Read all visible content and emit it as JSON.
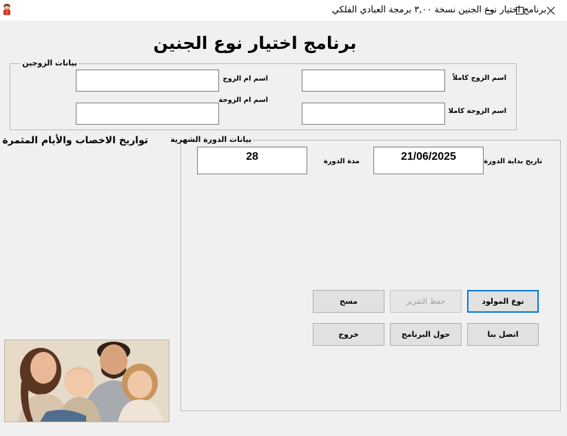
{
  "window": {
    "title": "برنامج اختيار نوع الجنين  نسخة ٣,٠٠ برمجة العبادي الفلكي",
    "icon": "app-icon"
  },
  "heading": "برنامج  اختيار نوع الجنين",
  "couple_group": {
    "legend": "بيانات الزوجين",
    "husband_full_name_label": "اسم الزوج كاملاً",
    "husband_mother_label": "اسم ام الزوج",
    "wife_full_name_label": "اسم الزوجة كاملا",
    "wife_mother_label": "اسم ام الزوجة",
    "husband_full_name_value": "",
    "husband_mother_value": "",
    "wife_full_name_value": "",
    "wife_mother_value": ""
  },
  "side_title": "تواريخ الاخصاب والأيام المثمرة",
  "cycle_group": {
    "legend": "بيانات الدورة الشهرية",
    "start_date_label": "تاريخ بداية الدورة",
    "start_date_value": "21/06/2025",
    "cycle_length_label": "مدة الدورة",
    "cycle_length_value": "28"
  },
  "buttons": {
    "baby_gender": "نوع المولود",
    "save_report": "حفظ التقرير",
    "clear": "مسح",
    "contact_us": "اتصل بنا",
    "about": "حول البرنامج",
    "exit": "خروج"
  },
  "colors": {
    "window_bg": "#f0f0f0",
    "titlebar_bg": "#ffffff",
    "default_button_border": "#0078d7",
    "disabled_text": "#a0a0a0"
  }
}
